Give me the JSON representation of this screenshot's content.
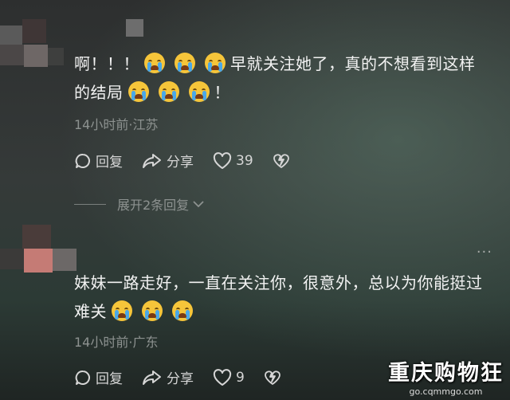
{
  "comments": [
    {
      "text_a": "啊！！！",
      "text_b": "早就关注她了，真的不想看到这样",
      "text_c": "的结局",
      "text_d": "！",
      "meta": "14小时前·江苏",
      "reply_label": "回复",
      "share_label": "分享",
      "likes": "39"
    },
    {
      "text_a": "妹妹一路走好，一直在关注你，很意外，总以为你能挺过",
      "text_b": "难关",
      "meta": "14小时前·广东",
      "reply_label": "回复",
      "share_label": "分享",
      "likes": "9"
    }
  ],
  "expand_replies": "展开2条回复",
  "more_icon": "···",
  "watermark": {
    "title": "重庆购物狂",
    "url": "go.cqmmgo.com"
  },
  "icons": [
    "crying-emoji-icon",
    "reply-bubble-icon",
    "share-arrow-icon",
    "heart-icon",
    "dislike-heart-icon",
    "chevron-down-icon",
    "more-icon"
  ]
}
